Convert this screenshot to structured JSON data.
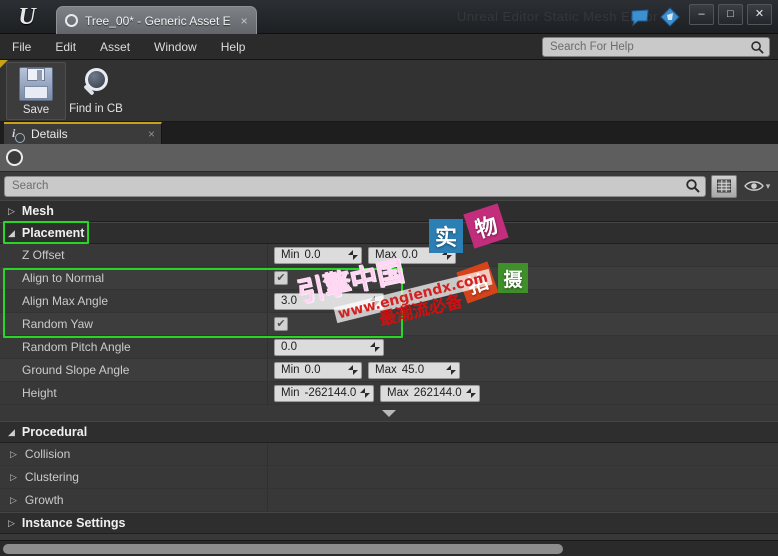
{
  "window": {
    "logo_glyph": "U",
    "document_tab": {
      "title": "Tree_00* - Generic Asset E",
      "close": "×",
      "status_icon": "circle-icon"
    },
    "ghost_title": "Unreal Editor Static Mesh Editor",
    "icons": [
      {
        "name": "feedback-icon",
        "color": "#2f7fc4"
      },
      {
        "name": "launcher-icon",
        "color": "#2f7fc4"
      }
    ],
    "controls": {
      "minimize": "–",
      "maximize": "□",
      "close": "✕"
    }
  },
  "menubar": {
    "items": [
      {
        "label": "File"
      },
      {
        "label": "Edit"
      },
      {
        "label": "Asset"
      },
      {
        "label": "Window"
      },
      {
        "label": "Help"
      }
    ],
    "help_search": {
      "placeholder": "Search For Help",
      "value": "",
      "icon": "search-icon"
    }
  },
  "toolbar": {
    "buttons": [
      {
        "label": "Save",
        "icon": "floppy-disk-icon",
        "selected": true
      },
      {
        "label": "Find in CB",
        "icon": "magnifier-icon",
        "selected": false
      }
    ]
  },
  "details_panel": {
    "tab": {
      "label": "Details",
      "close": "×",
      "icon": "details-info-icon"
    },
    "lock_icon": "lock-circle-icon",
    "search": {
      "placeholder": "Search",
      "value": "",
      "icon": "search-icon"
    },
    "view_options": {
      "grid_icon": "grid-view-icon",
      "eye_icon": "eye-icon",
      "chevron": "▾"
    }
  },
  "tree": {
    "categories": [
      {
        "name": "Mesh",
        "expanded": false,
        "tri": "▷"
      },
      {
        "name": "Placement",
        "expanded": true,
        "tri": "◢",
        "highlighted": true
      },
      {
        "name": "Procedural",
        "expanded": true,
        "tri": "◢"
      },
      {
        "name": "Instance Settings",
        "expanded": false,
        "tri": "▷"
      }
    ],
    "placement_rows": [
      {
        "label": "Z Offset",
        "type": "minmax",
        "min_prefix": "Min",
        "min_value": "0.0",
        "max_prefix": "Max",
        "max_value": "0.0"
      },
      {
        "label": "Align to Normal",
        "type": "checkbox",
        "checked": true,
        "check_glyph": "✔"
      },
      {
        "label": "Align Max Angle",
        "type": "number",
        "value": "3.0"
      },
      {
        "label": "Random Yaw",
        "type": "checkbox",
        "checked": true,
        "check_glyph": "✔"
      },
      {
        "label": "Random Pitch Angle",
        "type": "number",
        "value": "0.0"
      },
      {
        "label": "Ground Slope Angle",
        "type": "minmax",
        "min_prefix": "Min",
        "min_value": "0.0",
        "max_prefix": "Max",
        "max_value": "45.0"
      },
      {
        "label": "Height",
        "type": "minmax",
        "min_prefix": "Min",
        "min_value": "-262144.0",
        "max_prefix": "Max",
        "max_value": "262144.0"
      }
    ],
    "procedural_rows": [
      {
        "label": "Collision",
        "tri": "▷"
      },
      {
        "label": "Clustering",
        "tri": "▷"
      },
      {
        "label": "Growth",
        "tri": "▷"
      }
    ]
  },
  "watermarks": {
    "squares": [
      {
        "text": "实",
        "color": "#2b7fb4",
        "name": "watermark-shi"
      },
      {
        "text": "物",
        "color": "#c22d7c",
        "name": "watermark-wu"
      },
      {
        "text": "拍",
        "color": "#d4431c",
        "name": "watermark-pai"
      },
      {
        "text": "摄",
        "color": "#3f8f2a",
        "name": "watermark-she"
      }
    ],
    "brand_cn": "引擎中国",
    "url": "www.engiendx.com",
    "slogan": "最潮流必备"
  },
  "colors": {
    "accent_tab": "#c8a11a",
    "highlight_green": "#25d825",
    "panel_bg": "#383838",
    "field_bg": "#dcdcdc"
  }
}
